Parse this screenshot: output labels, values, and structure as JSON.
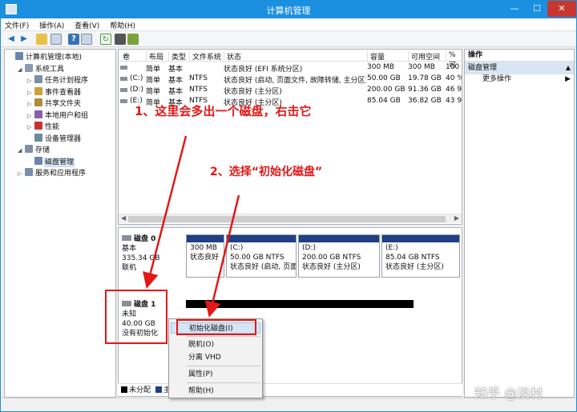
{
  "window": {
    "title": "计算机管理"
  },
  "menu": [
    "文件(F)",
    "操作(A)",
    "查看(V)",
    "帮助(H)"
  ],
  "tree": [
    {
      "label": "计算机管理(本地)",
      "caret": "",
      "level": 0,
      "selected": false
    },
    {
      "label": "系统工具",
      "caret": "◢",
      "level": 1,
      "selected": false
    },
    {
      "label": "任务计划程序",
      "caret": "▷",
      "level": 2,
      "selected": false
    },
    {
      "label": "事件查看器",
      "caret": "▷",
      "level": 2,
      "selected": false
    },
    {
      "label": "共享文件夹",
      "caret": "▷",
      "level": 2,
      "selected": false
    },
    {
      "label": "本地用户和组",
      "caret": "▷",
      "level": 2,
      "selected": false
    },
    {
      "label": "性能",
      "caret": "▷",
      "level": 2,
      "selected": false
    },
    {
      "label": "设备管理器",
      "caret": "",
      "level": 2,
      "selected": false
    },
    {
      "label": "存储",
      "caret": "◢",
      "level": 1,
      "selected": false
    },
    {
      "label": "磁盘管理",
      "caret": "",
      "level": 2,
      "selected": true
    },
    {
      "label": "服务和应用程序",
      "caret": "▷",
      "level": 1,
      "selected": false
    }
  ],
  "volume_headers": [
    "卷",
    "布局",
    "类型",
    "文件系统",
    "状态",
    "容量",
    "可用空间",
    "% 可"
  ],
  "volumes": [
    [
      "",
      "简单",
      "基本",
      "",
      "状态良好 (EFI 系统分区)",
      "300 MB",
      "300 MB",
      "100"
    ],
    [
      "(C:)",
      "简单",
      "基本",
      "NTFS",
      "状态良好 (启动, 页面文件, 故障转储, 主分区)",
      "50.00 GB",
      "19.78 GB",
      "40 %"
    ],
    [
      "(D:)",
      "简单",
      "基本",
      "NTFS",
      "状态良好 (主分区)",
      "200.00 GB",
      "91.36 GB",
      "46 9"
    ],
    [
      "(E:)",
      "简单",
      "基本",
      "NTFS",
      "状态良好 (主分区)",
      "85.04 GB",
      "36.82 GB",
      "43 9"
    ]
  ],
  "disk0": {
    "name": "磁盘 0",
    "type": "基本",
    "size": "335.34 GB",
    "status": "联机",
    "partitions": [
      {
        "label": "",
        "size": "300 MB",
        "status": "状态良好"
      },
      {
        "label": "(C:)",
        "size": "50.00 GB NTFS",
        "status": "状态良好 (启动, 页面"
      },
      {
        "label": "(D:)",
        "size": "200.00 GB NTFS",
        "status": "状态良好 (主分区)"
      },
      {
        "label": "(E:)",
        "size": "85.04 GB NTFS",
        "status": "状态良好 (主分区)"
      }
    ]
  },
  "disk1": {
    "name": "磁盘 1",
    "type": "未知",
    "size": "40.00 GB",
    "status": "没有初始化"
  },
  "legend": [
    {
      "label": "未分配",
      "color": "#000000"
    },
    {
      "label": "主",
      "color": "#1f3f86"
    }
  ],
  "actions": {
    "header": "操作",
    "section": "磁盘管理",
    "item": "更多操作"
  },
  "context_menu": [
    "初始化磁盘(I)",
    "脱机(O)",
    "分离 VHD",
    "属性(P)",
    "帮助(H)"
  ],
  "annotations": {
    "step1": "1、这里会多出一个磁盘，右击它",
    "step2": "2、选择“初始化磁盘”"
  },
  "watermark": "知乎 @淡村",
  "colors": {
    "accent": "#1b8fe0",
    "annotation": "#e21818",
    "primary_partition": "#1f3f86"
  }
}
